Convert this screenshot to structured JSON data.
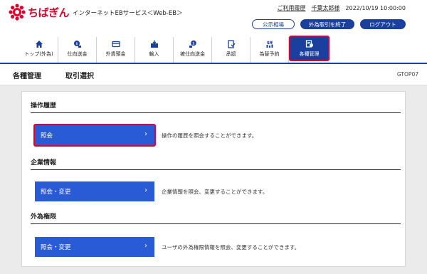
{
  "brand": {
    "name": "ちばぎん",
    "service": "インターネットEBサービス＜Web-EB＞",
    "accent": "#e3002d",
    "navy": "#1a3f9c"
  },
  "top_links": {
    "history": "ご利用履歴",
    "user": "千葉太郎様",
    "datetime": "2022/10/19 10:00:00"
  },
  "header_buttons": {
    "rates": "公示相場",
    "end_fx": "外為取引を終了",
    "logout": "ログアウト"
  },
  "nav": [
    {
      "label": "トップ(外為)",
      "icon": "home-icon"
    },
    {
      "label": "仕向送金",
      "icon": "remit-icon"
    },
    {
      "label": "外貨預金",
      "icon": "card-icon"
    },
    {
      "label": "輸入",
      "icon": "import-icon"
    },
    {
      "label": "被仕向送金",
      "icon": "receive-icon"
    },
    {
      "label": "承認",
      "icon": "approve-icon"
    },
    {
      "label": "為替予約",
      "icon": "forex-icon"
    },
    {
      "label": "各種管理",
      "icon": "manage-icon"
    }
  ],
  "page": {
    "title": "各種管理",
    "subtitle": "取引選択",
    "screen_id": "GTOP07"
  },
  "sections": [
    {
      "title": "操作履歴",
      "button": "照会",
      "description": "操作の履歴を照会することができます。"
    },
    {
      "title": "企業情報",
      "button": "照会・変更",
      "description": "企業情報を照会、変更することができます。"
    },
    {
      "title": "外為権限",
      "button": "照会・変更",
      "description": "ユーザの外為権限情報を照会、変更することができます。"
    }
  ]
}
